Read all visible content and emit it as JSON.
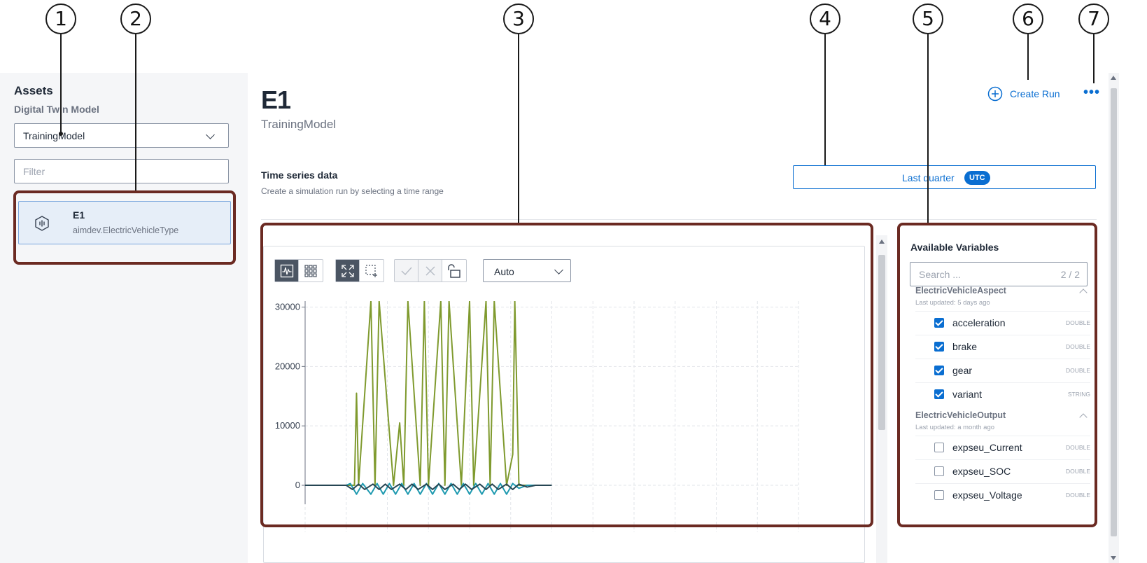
{
  "callouts": [
    "1",
    "2",
    "3",
    "4",
    "5",
    "6",
    "7"
  ],
  "assets_panel": {
    "title": "Assets",
    "model_label": "Digital Twin Model",
    "model_value": "TrainingModel",
    "filter_placeholder": "Filter",
    "asset": {
      "name": "E1",
      "type": "aimdev.ElectricVehicleType",
      "icon": "asset-signal-icon"
    }
  },
  "header": {
    "title": "E1",
    "subtitle": "TrainingModel",
    "create_run_label": "Create Run",
    "more_label": "•••"
  },
  "time_series": {
    "title": "Time series data",
    "description": "Create a simulation run by selecting a time range",
    "range_label": "Last quarter",
    "timezone_badge": "UTC"
  },
  "chart_toolbar": {
    "view_buttons": [
      "line-chart-icon",
      "grid-view-icon"
    ],
    "zoom_buttons": [
      "fit-zoom-icon",
      "box-select-icon"
    ],
    "edit_buttons": [
      "check-icon",
      "close-icon",
      "unlock-icon"
    ],
    "interval_value": "Auto"
  },
  "chart_data": {
    "type": "line",
    "ylim": [
      -2000,
      31000
    ],
    "yticks": [
      0,
      10000,
      20000,
      30000
    ],
    "ytick_labels": [
      "0",
      "10000",
      "20000",
      "30000"
    ],
    "grid": true,
    "series": [
      {
        "color": "#7f9a2e",
        "x": [
          0,
          100,
          120,
          125,
          130,
          160,
          170,
          180,
          215,
          230,
          240,
          250,
          280,
          290,
          300,
          330,
          340,
          350,
          380,
          400,
          410,
          440,
          450,
          460,
          490,
          505,
          510,
          520,
          540,
          570,
          590,
          600
        ],
        "y": [
          0,
          0,
          0,
          15500,
          0,
          31000,
          0,
          31000,
          0,
          10500,
          0,
          31000,
          0,
          31000,
          0,
          31000,
          0,
          31000,
          0,
          31000,
          0,
          31000,
          0,
          31000,
          0,
          5200,
          31000,
          0,
          0,
          0,
          0,
          0
        ]
      },
      {
        "color": "#1f9ab0",
        "x": [
          0,
          100,
          110,
          125,
          140,
          160,
          175,
          190,
          205,
          220,
          235,
          250,
          265,
          280,
          295,
          310,
          325,
          340,
          355,
          370,
          385,
          400,
          415,
          430,
          445,
          460,
          475,
          490,
          505,
          520,
          540,
          560,
          600
        ],
        "y": [
          0,
          0,
          300,
          -1500,
          300,
          -1500,
          300,
          -1500,
          300,
          -1500,
          300,
          -1500,
          300,
          -1500,
          300,
          -1500,
          300,
          -1500,
          300,
          -1500,
          300,
          -1500,
          300,
          -1500,
          300,
          -1500,
          300,
          -1500,
          300,
          -500,
          0,
          0,
          0
        ]
      },
      {
        "color": "#264653",
        "x": [
          0,
          100,
          115,
          130,
          145,
          165,
          180,
          195,
          210,
          230,
          245,
          260,
          275,
          295,
          310,
          325,
          340,
          360,
          375,
          390,
          405,
          425,
          440,
          455,
          470,
          490,
          505,
          520,
          540,
          560,
          600
        ],
        "y": [
          0,
          0,
          -700,
          200,
          -700,
          200,
          -700,
          200,
          -700,
          200,
          -700,
          200,
          -700,
          200,
          -700,
          200,
          -700,
          200,
          -700,
          200,
          -700,
          200,
          -700,
          200,
          -700,
          200,
          -700,
          200,
          -300,
          0,
          0
        ]
      }
    ]
  },
  "variables_panel": {
    "title": "Available Variables",
    "search_placeholder": "Search ...",
    "count": "2 / 2",
    "groups": [
      {
        "name": "ElectricVehicleAspect",
        "updated": "Last updated: 5 days ago",
        "items": [
          {
            "name": "acceleration",
            "type": "DOUBLE",
            "checked": true
          },
          {
            "name": "brake",
            "type": "DOUBLE",
            "checked": true
          },
          {
            "name": "gear",
            "type": "DOUBLE",
            "checked": true
          },
          {
            "name": "variant",
            "type": "STRING",
            "checked": true
          }
        ]
      },
      {
        "name": "ElectricVehicleOutput",
        "updated": "Last updated: a month ago",
        "items": [
          {
            "name": "expseu_Current",
            "type": "DOUBLE",
            "checked": false
          },
          {
            "name": "expseu_SOC",
            "type": "DOUBLE",
            "checked": false
          },
          {
            "name": "expseu_Voltage",
            "type": "DOUBLE",
            "checked": false
          }
        ]
      }
    ]
  },
  "colors": {
    "accent": "#0a6ed1",
    "highlight": "#6b2a22"
  }
}
